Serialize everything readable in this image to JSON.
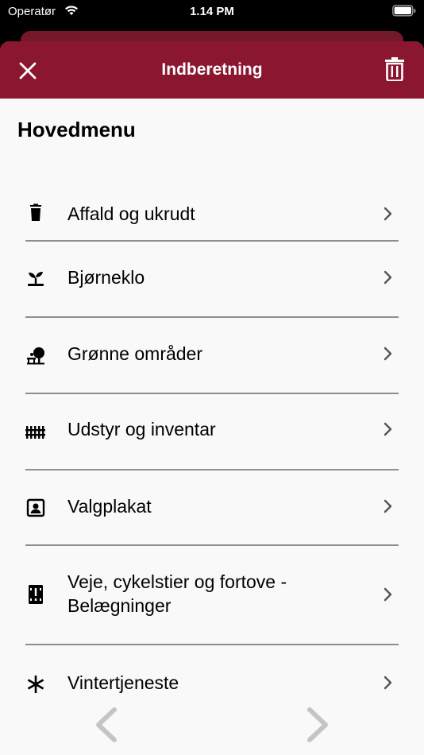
{
  "status_bar": {
    "carrier": "Operatør",
    "time": "1.14 PM"
  },
  "header": {
    "title": "Indberetning",
    "close_icon": "close-icon",
    "delete_icon": "trash-icon",
    "color": "#8b1630"
  },
  "main": {
    "title": "Hovedmenu",
    "items": [
      {
        "label": "Affald og ukrudt",
        "icon": "trash-can-icon"
      },
      {
        "label": "Bjørneklo",
        "icon": "sprout-icon"
      },
      {
        "label": "Grønne områder",
        "icon": "tree-bench-icon"
      },
      {
        "label": "Udstyr og inventar",
        "icon": "fence-icon"
      },
      {
        "label": "Valgplakat",
        "icon": "portrait-icon"
      },
      {
        "label": "Veje, cykelstier og fortove -",
        "label_line2": "Belægninger",
        "icon": "road-warning-icon"
      },
      {
        "label": "Vintertjeneste",
        "icon": "snowflake-icon"
      }
    ]
  },
  "bottom_nav": {
    "prev_icon": "chevron-left-icon",
    "next_icon": "chevron-right-icon"
  }
}
